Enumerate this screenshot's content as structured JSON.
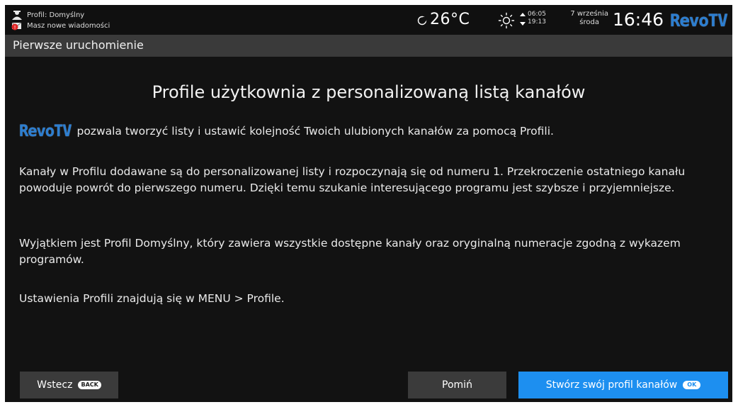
{
  "status_bar": {
    "profile_label": "Profil: Domyślny",
    "messages_label": "Masz nowe wiadomości",
    "weather_icon": "moon-icon",
    "temperature": "26°C",
    "sun_icon": "sun-icon",
    "sunrise": "06:05",
    "sunset": "19:13",
    "date_day_month": "7 września",
    "date_weekday": "środa",
    "clock": "16:46",
    "brand": "RevoTV",
    "brand_color": "#2b7ed1"
  },
  "title_bar": {
    "title": "Pierwsze uruchomienie"
  },
  "content": {
    "heading": "Profile użytkownia z personalizowaną listą kanałów",
    "brand_inline": "RevoTV",
    "intro": "pozwala tworzyć listy i ustawić kolejność Twoich ulubionych kanałów za pomocą Profili.",
    "paragraph1": "Kanały w Profilu dodawane są do personalizowanej listy i rozpoczynają się od numeru 1. Przekroczenie ostatniego kanału powoduje powrót do pierwszego numeru. Dzięki temu szukanie interesującego programu jest szybsze i przyjemniejsze.",
    "paragraph2": "Wyjątkiem jest Profil Domyślny, który zawiera wszystkie dostępne kanały oraz oryginalną numeracje zgodną z wykazem programów.",
    "paragraph3": "Ustawienia Profili znajdują się w MENU > Profile."
  },
  "buttons": {
    "back_label": "Wstecz",
    "back_key": "BACK",
    "skip_label": "Pomiń",
    "create_label": "Stwórz swój profil kanałów",
    "create_key": "OK",
    "accent_color": "#1d8ff0"
  }
}
